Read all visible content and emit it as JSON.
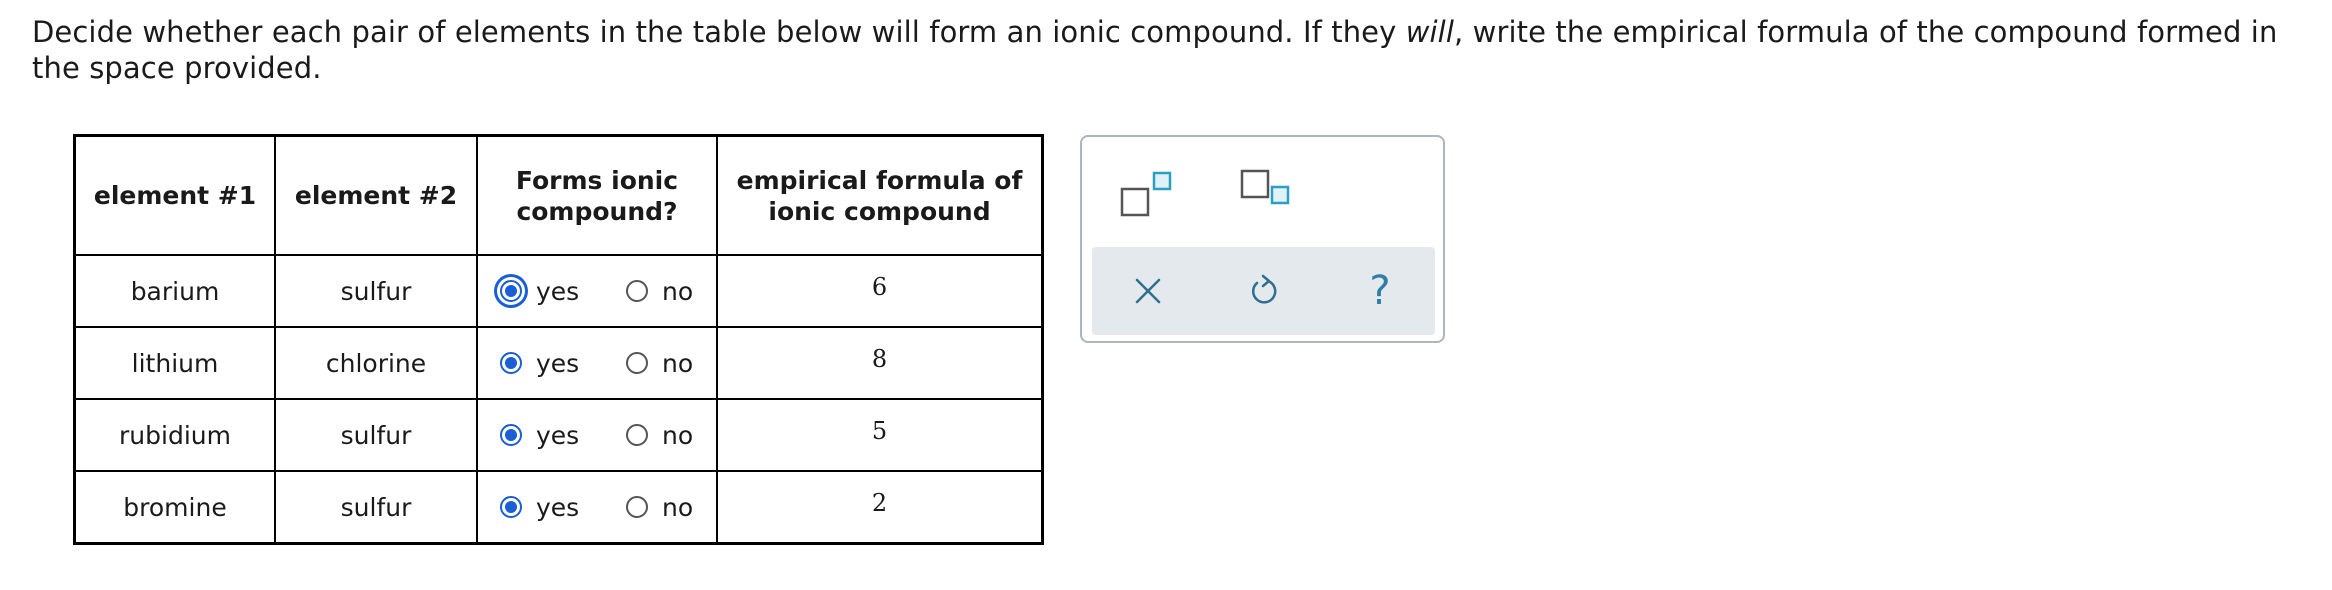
{
  "prompt": {
    "part1": "Decide whether each pair of elements in the table below will form an ionic compound. If they ",
    "emph": "will",
    "part2": ", write the empirical formula of the compound formed in the space provided."
  },
  "table": {
    "headers": {
      "element1": "element #1",
      "element2": "element #2",
      "forms_ionic_line1": "Forms ionic",
      "forms_ionic_line2": "compound?",
      "formula_line1": "empirical formula of",
      "formula_line2": "ionic compound"
    },
    "yes_label": "yes",
    "no_label": "no",
    "rows": [
      {
        "element1": "barium",
        "element2": "sulfur",
        "selected": "yes",
        "formula": "6"
      },
      {
        "element1": "lithium",
        "element2": "chlorine",
        "selected": "yes",
        "formula": "8"
      },
      {
        "element1": "rubidium",
        "element2": "sulfur",
        "selected": "yes",
        "formula": "5"
      },
      {
        "element1": "bromine",
        "element2": "sulfur",
        "selected": "yes",
        "formula": "2"
      }
    ]
  },
  "tools": {
    "superscript_icon": "superscript-icon",
    "subscript_icon": "subscript-icon",
    "clear_icon": "close-icon",
    "undo_icon": "undo-icon",
    "help_glyph": "?"
  },
  "colors": {
    "radio_selected": "#1a5fd6",
    "tool_accent": "#2e9ec0",
    "tool_icon": "#2e6f8f",
    "panel_border": "#a9b7c0",
    "panel_action_bg": "#e3e9ec"
  }
}
